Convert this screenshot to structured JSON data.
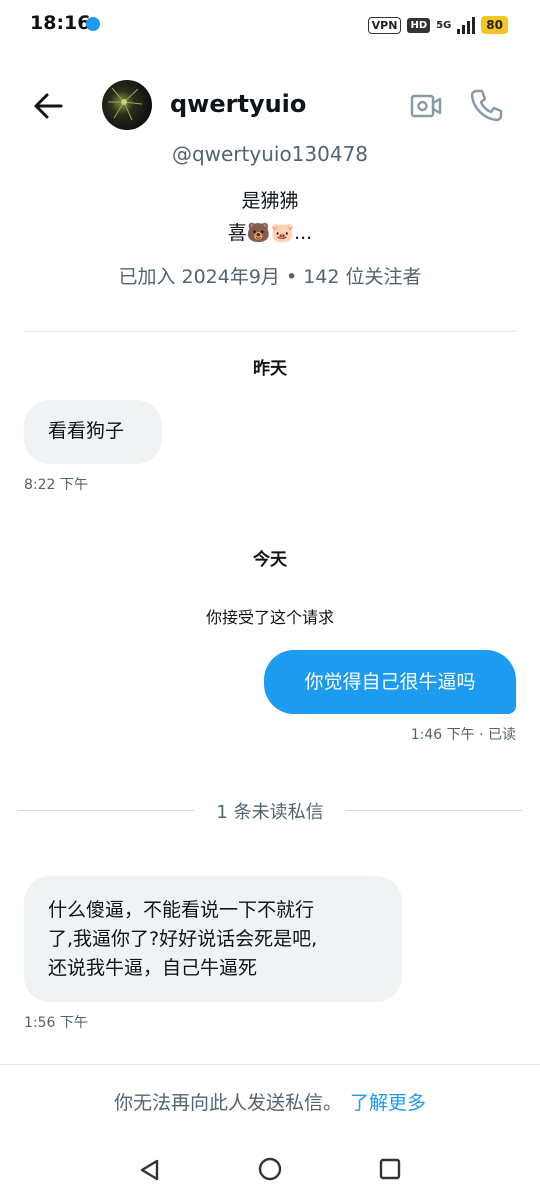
{
  "status_bar": {
    "time": "18:16",
    "vpn": "VPN",
    "hd": "HD",
    "network": "5G",
    "battery": "80"
  },
  "header": {
    "name": "qwertyuio",
    "icons": {
      "back": "arrow-left-icon",
      "video": "video-camera-icon",
      "phone": "phone-icon"
    }
  },
  "profile": {
    "handle": "@qwertyuio130478",
    "bio_line1": "是狒狒",
    "bio_line2": "喜🐻🐷...",
    "meta": "已加入 2024年9月 • 142 位关注者"
  },
  "conversation": {
    "yesterday_label": "昨天",
    "msg1": {
      "text": "看看狗子",
      "time": "8:22 下午"
    },
    "today_label": "今天",
    "system_accept": "你接受了这个请求",
    "msg2": {
      "text": "你觉得自己很牛逼吗",
      "time": "1:46 下午 · 已读"
    },
    "unread_divider": "1 条未读私信",
    "msg3": {
      "line1": "什么傻逼，不能看说一下不就行",
      "line2": "了,我逼你了?好好说话会死是吧,",
      "line3": "还说我牛逼，自己牛逼死",
      "time": "1:56 下午"
    }
  },
  "footer": {
    "notice": "你无法再向此人发送私信。",
    "learn_more": "了解更多"
  },
  "colors": {
    "accent": "#1d9bf0",
    "bubble_in": "#eff3f4",
    "muted_text": "#536471"
  }
}
